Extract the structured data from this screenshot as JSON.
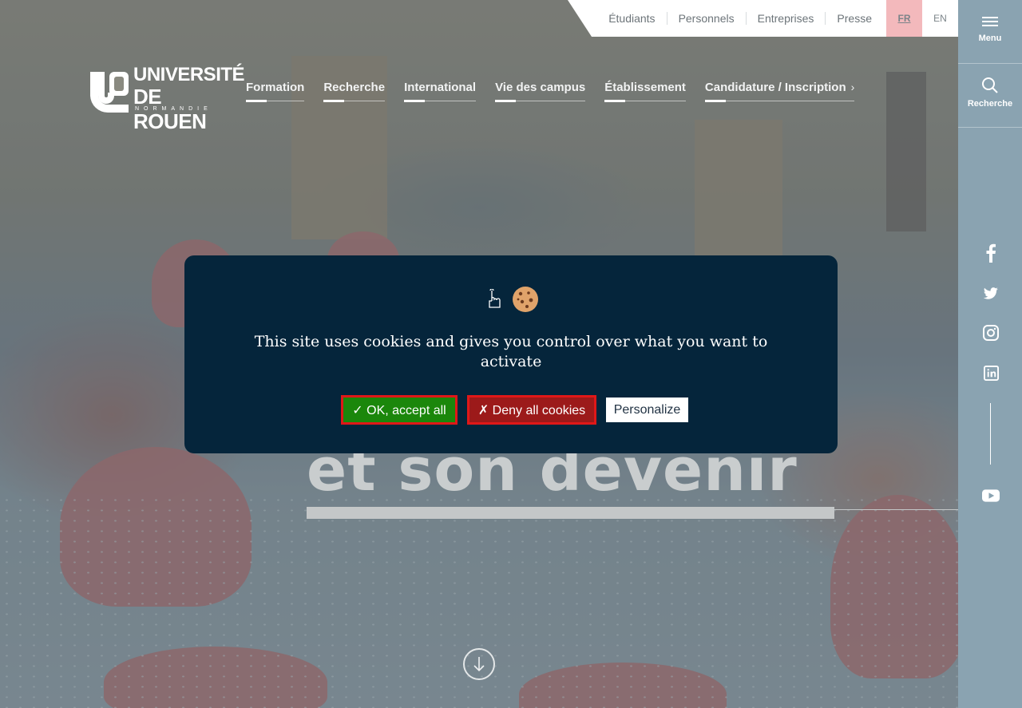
{
  "utility_nav": {
    "links": [
      "Étudiants",
      "Personnels",
      "Entreprises",
      "Presse"
    ]
  },
  "languages": {
    "active": "FR",
    "other": "EN"
  },
  "logo": {
    "line1": "UNIVERSITÉ",
    "line2": "DE ROUEN",
    "line3": "NORMANDIE"
  },
  "main_nav": {
    "items": [
      "Formation",
      "Recherche",
      "International",
      "Vie des campus",
      "Établissement",
      "Candidature / Inscription"
    ]
  },
  "sidebar": {
    "menu_label": "Menu",
    "search_label": "Recherche",
    "social": [
      "facebook-icon",
      "twitter-icon",
      "instagram-icon",
      "linkedin-icon",
      "youtube-icon"
    ]
  },
  "hero": {
    "title_visible": "et son devenir"
  },
  "cookie_banner": {
    "message": "This site uses cookies and gives you control over what you want to activate",
    "accept_label": "✓ OK, accept all",
    "deny_label": "✗ Deny all cookies",
    "personalize_label": "Personalize"
  },
  "colors": {
    "sidebar": "#8aa3b1",
    "cookie_bg": "#05253b",
    "accept_green": "#1b870b",
    "deny_red": "#9c1a1a",
    "lang_active": "#f3b9bc"
  }
}
